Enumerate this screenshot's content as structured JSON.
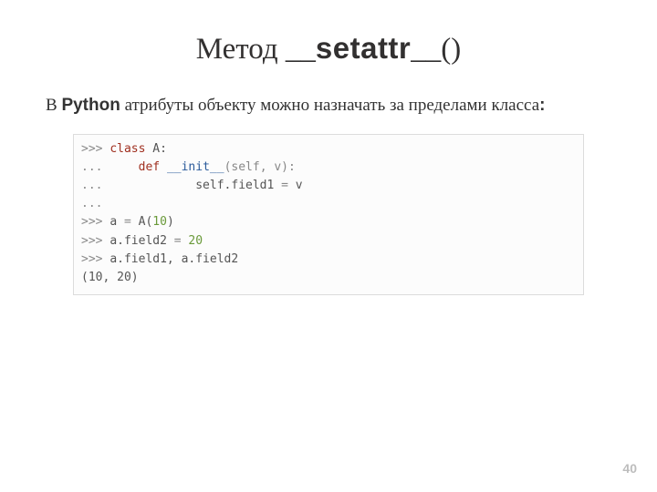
{
  "title": {
    "pre": "Метод __",
    "mid": "setattr",
    "post": "__()"
  },
  "paragraph": {
    "p1": "В ",
    "python": "Python",
    "p2": " атрибуты объекту можно назначать за пределами класса",
    "colon": ":"
  },
  "code": {
    "l1": {
      "p": ">>> ",
      "kw": "class",
      "sp": " ",
      "name": "A:"
    },
    "l2": {
      "p": "...     ",
      "kw": "def",
      "sp": " ",
      "fn": "__init__",
      "args": "(self, v):"
    },
    "l3": {
      "p": "...             ",
      "stmt1": "self.field1 ",
      "eq": "=",
      "stmt2": " v"
    },
    "l4": {
      "p": "..."
    },
    "l5": {
      "p": ">>> ",
      "stmt": "a ",
      "eq": "=",
      "sp": " A(",
      "num": "10",
      "end": ")"
    },
    "l6": {
      "p": ">>> ",
      "stmt": "a.field2 ",
      "eq": "=",
      "sp": " ",
      "num": "20"
    },
    "l7": {
      "p": ">>> ",
      "stmt": "a.field1, a.field2"
    },
    "l8": {
      "res": "(10, 20)"
    }
  },
  "page_number": "40"
}
